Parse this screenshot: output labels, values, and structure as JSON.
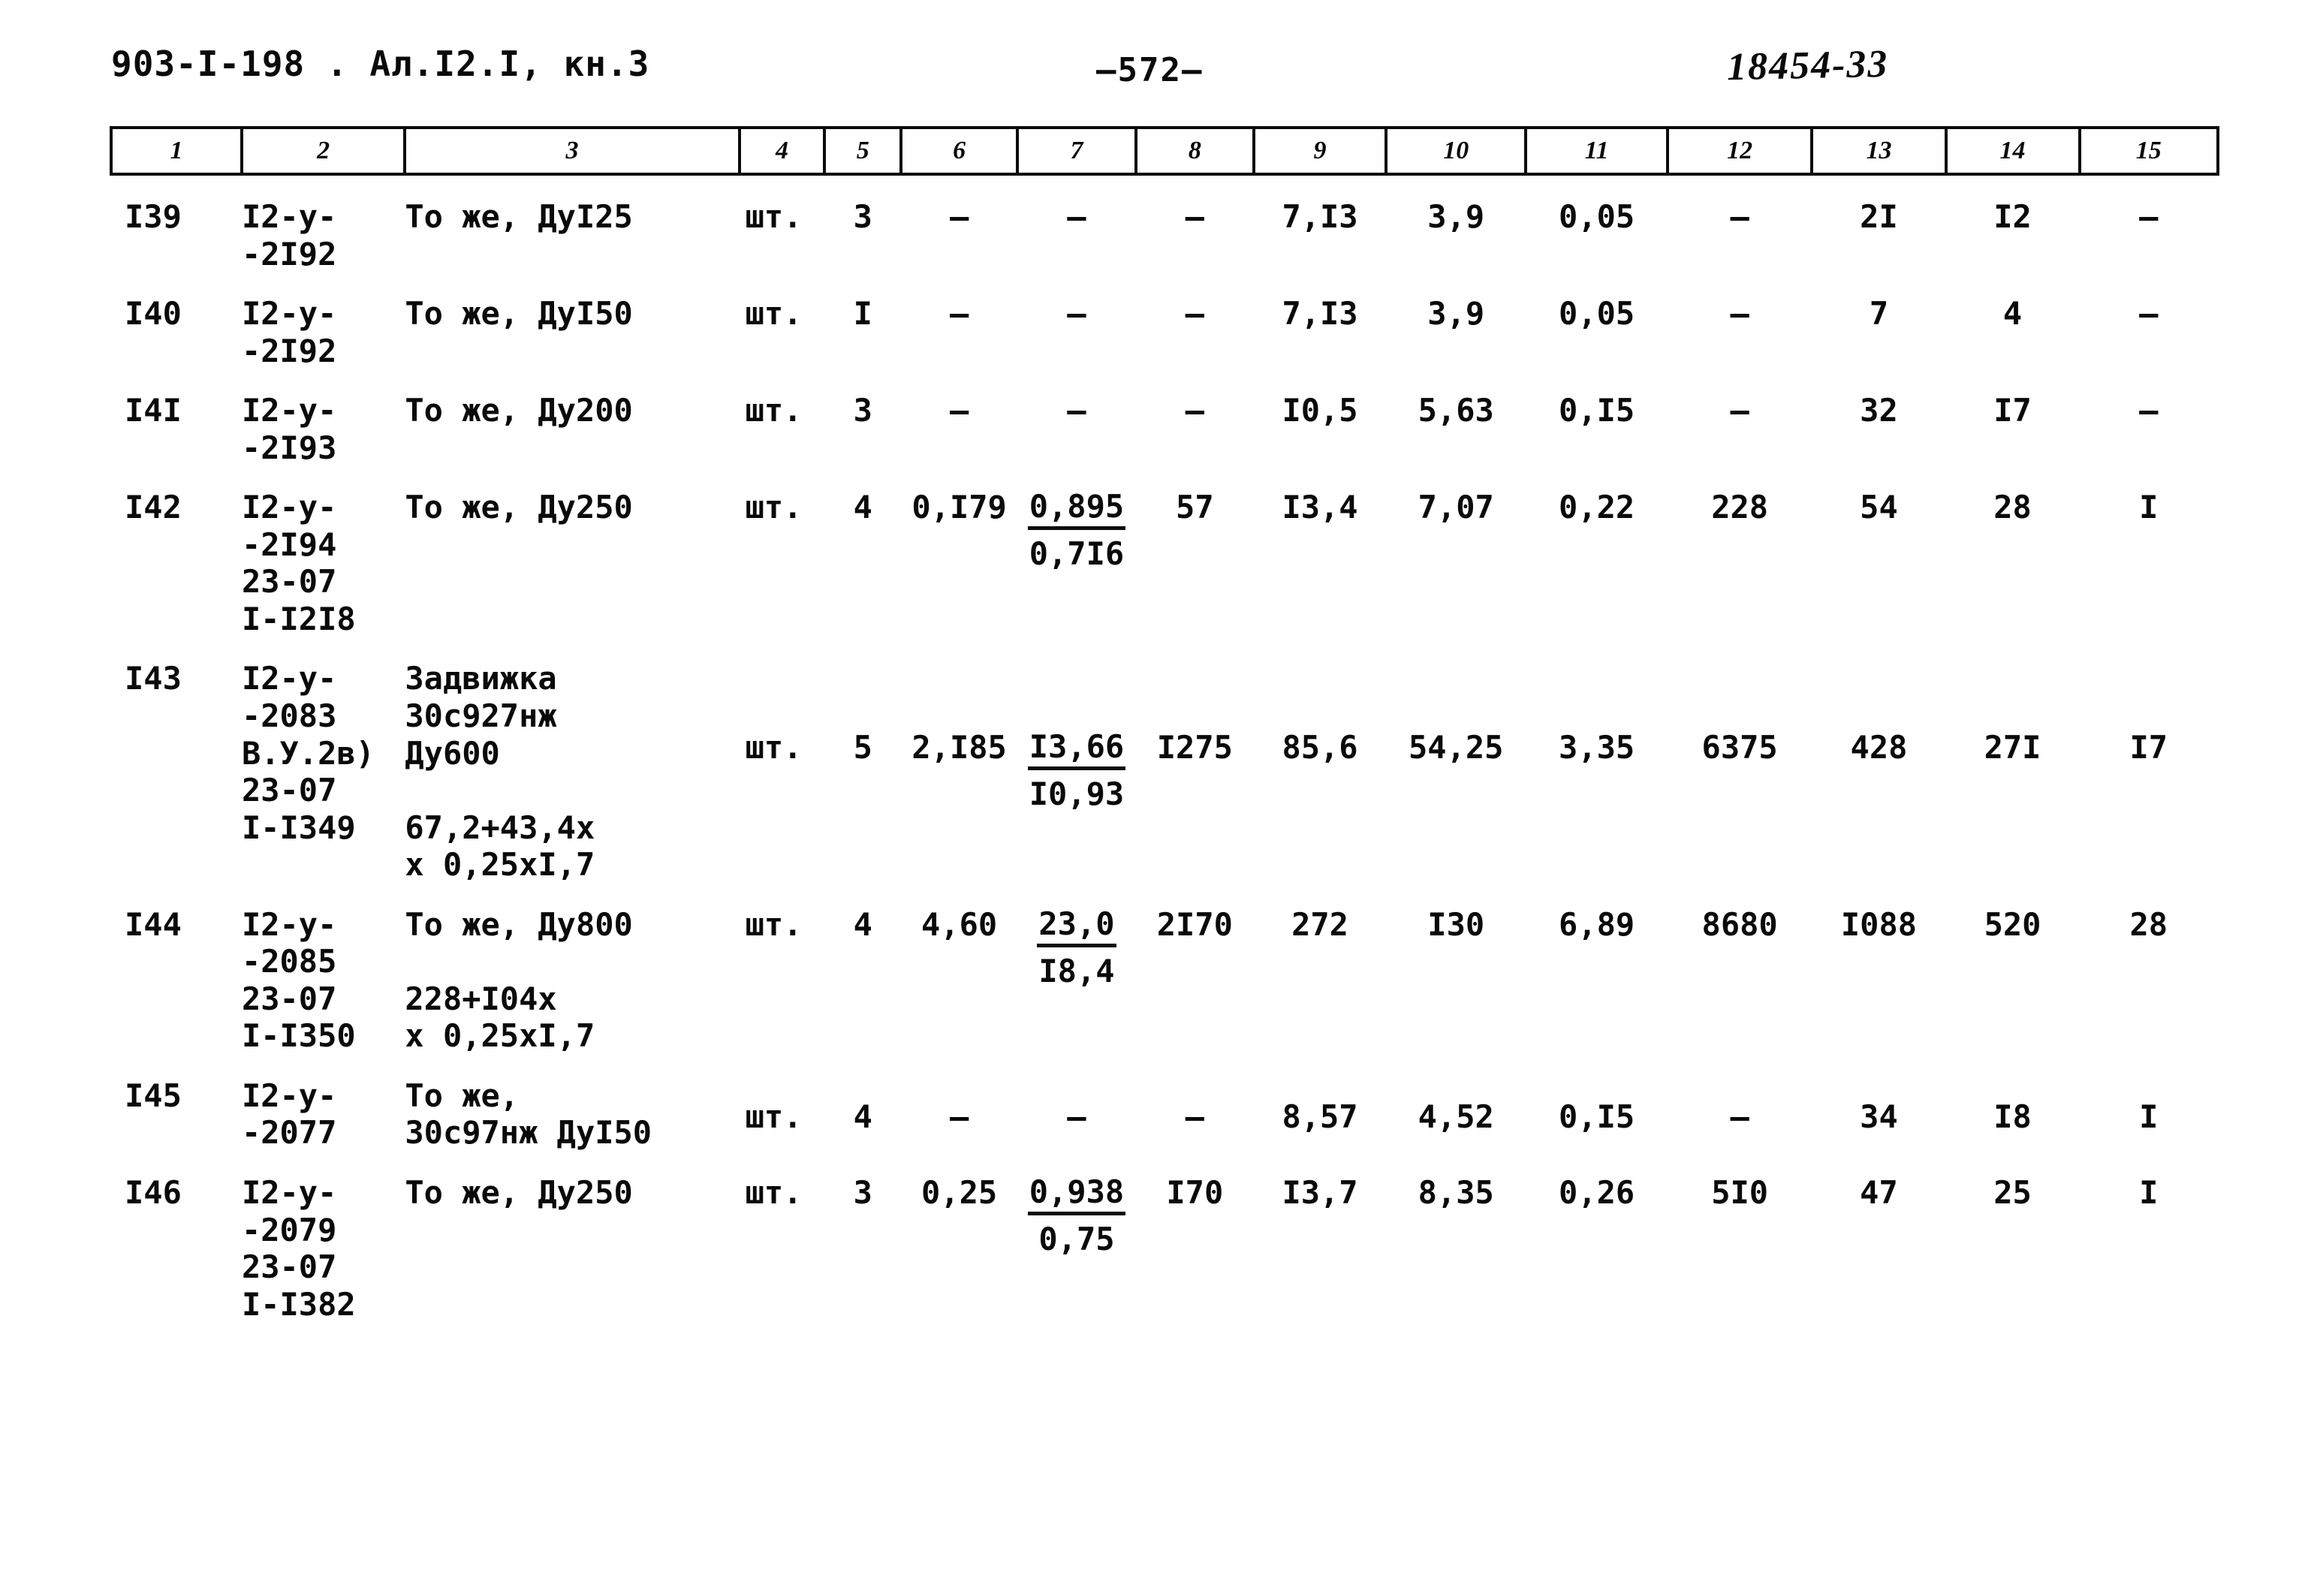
{
  "header": {
    "left": "903-I-198 . Ал.I2.I, кн.3",
    "center": "—572—",
    "right_stamp": "18454-33"
  },
  "table": {
    "column_headers": [
      "1",
      "2",
      "3",
      "4",
      "5",
      "6",
      "7",
      "8",
      "9",
      "10",
      "11",
      "12",
      "13",
      "14",
      "15"
    ],
    "rows": [
      {
        "index": "I39",
        "code": "I2-у-\n-2I92",
        "name": "То же, ДуI25",
        "unit": "шт.",
        "qty": "3",
        "c6": "–",
        "c7_num": "–",
        "c7_den": "",
        "c8": "–",
        "c9": "7,I3",
        "c10": "3,9",
        "c11": "0,05",
        "c12": "–",
        "c13": "2I",
        "c14": "I2",
        "c15": "–"
      },
      {
        "index": "I40",
        "code": "I2-у-\n-2I92",
        "name": "То же, ДуI50",
        "unit": "шт.",
        "qty": "I",
        "c6": "–",
        "c7_num": "–",
        "c7_den": "",
        "c8": "–",
        "c9": "7,I3",
        "c10": "3,9",
        "c11": "0,05",
        "c12": "–",
        "c13": "7",
        "c14": "4",
        "c15": "–"
      },
      {
        "index": "I4I",
        "code": "I2-у-\n-2I93",
        "name": "То же, Ду200",
        "unit": "шт.",
        "qty": "3",
        "c6": "–",
        "c7_num": "–",
        "c7_den": "",
        "c8": "–",
        "c9": "I0,5",
        "c10": "5,63",
        "c11": "0,I5",
        "c12": "–",
        "c13": "32",
        "c14": "I7",
        "c15": "–"
      },
      {
        "index": "I42",
        "code": "I2-у-\n-2I94\n23-07\nI-I2I8",
        "name": "То же, Ду250",
        "unit": "шт.",
        "qty": "4",
        "c6": "0,I79",
        "c7_num": "0,895",
        "c7_den": "0,7I6",
        "c8": "57",
        "c9": "I3,4",
        "c10": "7,07",
        "c11": "0,22",
        "c12": "228",
        "c13": "54",
        "c14": "28",
        "c15": "I"
      },
      {
        "index": "I43",
        "code": "I2-у-\n-2083\nВ.У.2в)\n23-07\nI-I349",
        "name": "Задвижка\n30с927нж\nДу600\n\n67,2+43,4х\nх 0,25хI,7",
        "unit": "шт.",
        "qty": "5",
        "c6": "2,I85",
        "c7_num": "I3,66",
        "c7_den": "I0,93",
        "c8": "I275",
        "c9": "85,6",
        "c10": "54,25",
        "c11": "3,35",
        "c12": "6375",
        "c13": "428",
        "c14": "27I",
        "c15": "I7"
      },
      {
        "index": "I44",
        "code": "I2-у-\n-2085\n23-07\nI-I350",
        "name": "То же, Ду800\n\n228+I04х\nх 0,25хI,7",
        "unit": "шт.",
        "qty": "4",
        "c6": "4,60",
        "c7_num": "23,0",
        "c7_den": "I8,4",
        "c8": "2I70",
        "c9": "272",
        "c10": "I30",
        "c11": "6,89",
        "c12": "8680",
        "c13": "I088",
        "c14": "520",
        "c15": "28"
      },
      {
        "index": "I45",
        "code": "I2-у-\n-2077",
        "name": "То же,\n30с97нж ДуI50",
        "unit": "шт.",
        "qty": "4",
        "c6": "–",
        "c7_num": "–",
        "c7_den": "",
        "c8": "–",
        "c9": "8,57",
        "c10": "4,52",
        "c11": "0,I5",
        "c12": "–",
        "c13": "34",
        "c14": "I8",
        "c15": "I"
      },
      {
        "index": "I46",
        "code": "I2-у-\n-2079\n23-07\nI-I382",
        "name": "То же, Ду250",
        "unit": "шт.",
        "qty": "3",
        "c6": "0,25",
        "c7_num": "0,938",
        "c7_den": "0,75",
        "c8": "I70",
        "c9": "I3,7",
        "c10": "8,35",
        "c11": "0,26",
        "c12": "5I0",
        "c13": "47",
        "c14": "25",
        "c15": "I"
      }
    ]
  }
}
